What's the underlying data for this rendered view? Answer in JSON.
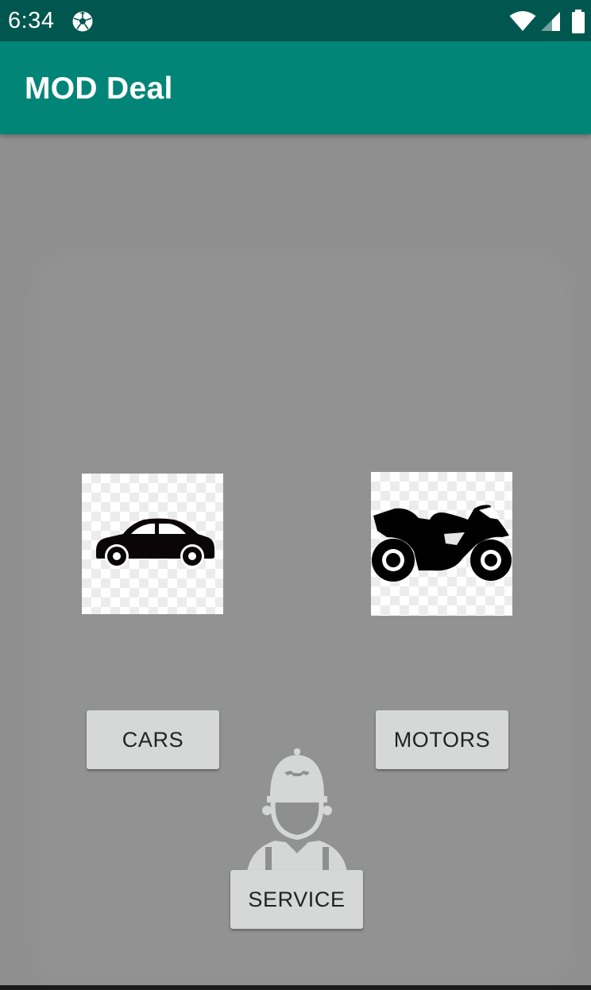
{
  "status_bar": {
    "time": "6:34"
  },
  "app_bar": {
    "title": "MOD Deal"
  },
  "buttons": {
    "cars": "CARS",
    "motors": "MOTORS",
    "service": "SERVICE"
  },
  "icons": {
    "notification": "soccer-ball-icon",
    "wifi": "wifi-icon",
    "signal": "cell-signal-icon",
    "battery": "battery-icon",
    "car": "car-icon",
    "motorcycle": "motorcycle-icon",
    "mechanic": "mechanic-icon"
  },
  "colors": {
    "status_bar": "#00574f",
    "app_bar": "#008577",
    "background": "#8f8f8f",
    "button": "#d6d7d7"
  }
}
